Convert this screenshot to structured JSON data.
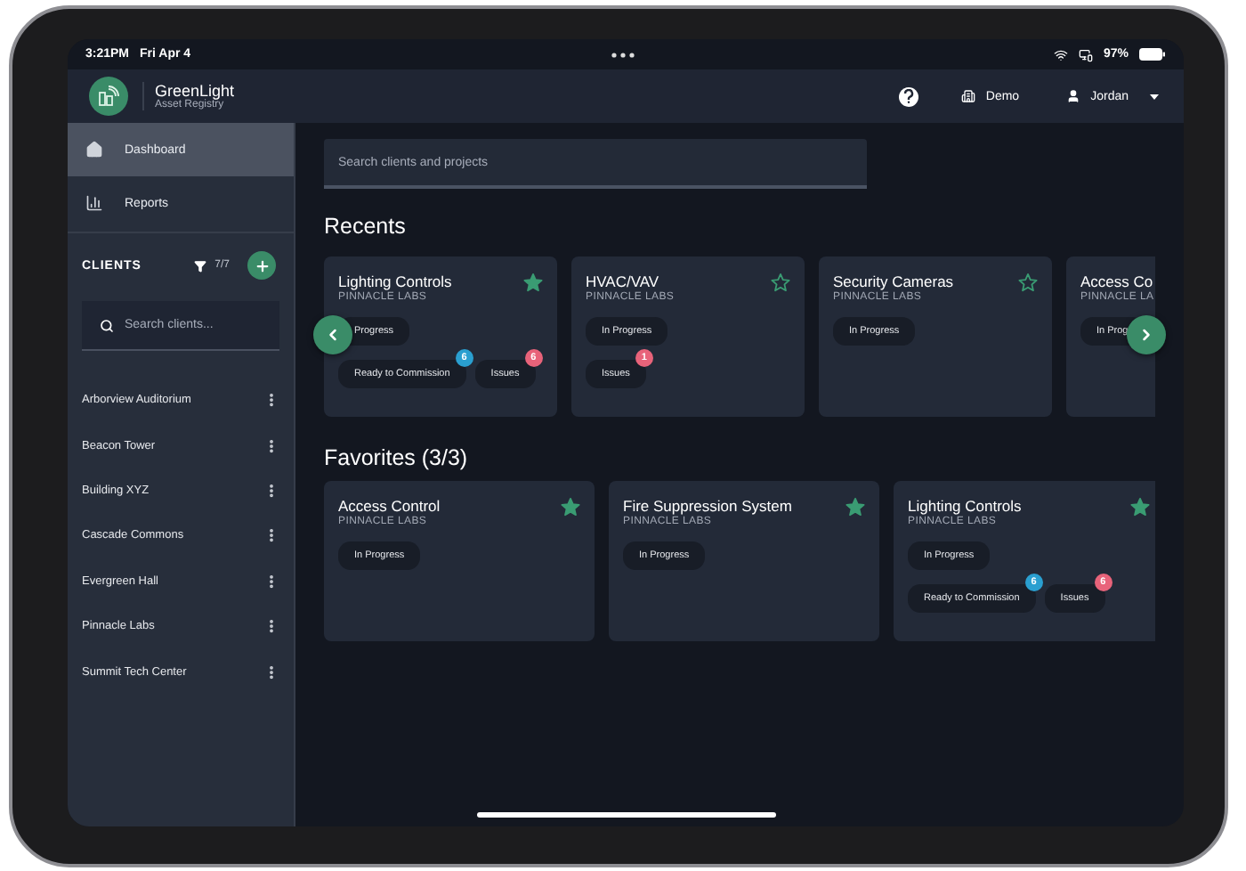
{
  "status_bar": {
    "time": "3:21PM",
    "date": "Fri Apr 4",
    "battery": "97%"
  },
  "header": {
    "app_name": "GreenLight",
    "app_subtitle": "Asset Registry",
    "workspace": "Demo",
    "user": "Jordan"
  },
  "sidebar": {
    "nav": [
      {
        "label": "Dashboard",
        "kind": "home",
        "selected": true
      },
      {
        "label": "Reports",
        "kind": "chart",
        "selected": false
      }
    ],
    "clients_heading": "CLIENTS",
    "client_count": "7/7",
    "search": {
      "placeholder": "Search clients..."
    },
    "clients": [
      "Arborview Auditorium",
      "Beacon Tower",
      "Building XYZ",
      "Cascade Commons",
      "Evergreen Hall",
      "Pinnacle Labs",
      "Summit Tech Center"
    ]
  },
  "main": {
    "search": {
      "placeholder": "Search clients and projects"
    },
    "recents": {
      "title": "Recents",
      "cards": [
        {
          "title": "Lighting Controls",
          "client": "PINNACLE LABS",
          "favorite": true,
          "status": "Progress",
          "tags": [
            {
              "label": "Ready to Commission",
              "kind": "commission",
              "count": "6"
            },
            {
              "label": "Issues",
              "kind": "issues",
              "count": "6"
            }
          ]
        },
        {
          "title": "HVAC/VAV",
          "client": "PINNACLE LABS",
          "favorite": false,
          "status": "In Progress",
          "tags": [
            {
              "label": "Issues",
              "kind": "issues",
              "count": "1"
            }
          ]
        },
        {
          "title": "Security Cameras",
          "client": "PINNACLE LABS",
          "favorite": false,
          "status": "In Progress"
        },
        {
          "title": "Access Co",
          "client": "PINNACLE LA",
          "status": "In Prog"
        }
      ]
    },
    "favorites": {
      "title": "Favorites (3/3)",
      "cards": [
        {
          "title": "Access Control",
          "client": "PINNACLE LABS",
          "favorite": true,
          "status": "In Progress"
        },
        {
          "title": "Fire Suppression System",
          "client": "PINNACLE LABS",
          "favorite": true,
          "status": "In Progress"
        },
        {
          "title": "Lighting Controls",
          "client": "PINNACLE LABS",
          "favorite": true,
          "status": "In Progress",
          "tags": [
            {
              "label": "Ready to Commission",
              "kind": "commission",
              "count": "6"
            },
            {
              "label": "Issues",
              "kind": "issues",
              "count": "6"
            }
          ]
        }
      ]
    }
  }
}
